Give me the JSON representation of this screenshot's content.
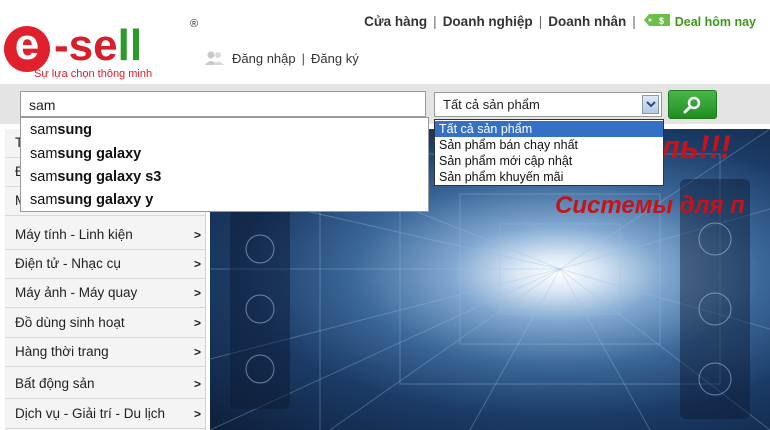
{
  "brand": {
    "logo_e": "e",
    "logo_rest_1": "-se",
    "logo_rest_l1": "l",
    "logo_rest_l2": "l",
    "registered": "®",
    "slogan": "Sự lựa chọn thông minh",
    "color_red": "#d81e28",
    "color_green": "#2a9a2a"
  },
  "auth": {
    "login": "Đăng nhập",
    "separator": "|",
    "register": "Đăng ký"
  },
  "top_nav": {
    "items": [
      "Cửa hàng",
      "Doanh nghiệp",
      "Doanh nhân"
    ],
    "separator": "|",
    "deal": "Deal hôm nay",
    "deal_icon_text": "$"
  },
  "search": {
    "value": "sam",
    "category_selected": "Tất cả sản phẩm",
    "button_icon": "search-icon"
  },
  "suggestions": [
    {
      "typed": "sam",
      "rest": "sung"
    },
    {
      "typed": "sam",
      "rest": "sung galaxy"
    },
    {
      "typed": "sam",
      "rest": "sung galaxy s3"
    },
    {
      "typed": "sam",
      "rest": "sung galaxy y"
    }
  ],
  "category_options": [
    "Tất cả sản phẩm",
    "Sản phẩm bán chạy nhất",
    "Sản phẩm mới cập nhật",
    "Sản phẩm khuyến mãi"
  ],
  "sidebar": {
    "arrow": ">",
    "items": [
      {
        "label": "T"
      },
      {
        "label": "Đ"
      },
      {
        "label": "M"
      },
      {
        "label": "Máy tính - Linh kiện"
      },
      {
        "label": "Điện tử - Nhạc cụ"
      },
      {
        "label": "Máy ảnh - Máy quay"
      },
      {
        "label": "Đồ dùng sinh hoạt"
      },
      {
        "label": "Hàng thời trang"
      },
      {
        "label": "Bất động sản"
      },
      {
        "label": "Dịch vụ - Giải trí - Du lịch"
      }
    ]
  },
  "banner": {
    "text1": "ль!!!",
    "text2": "Системы для п"
  }
}
